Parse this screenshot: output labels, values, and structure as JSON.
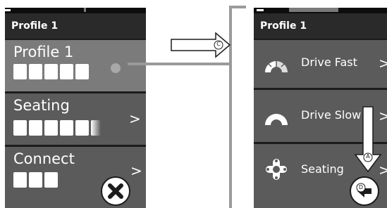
{
  "left": {
    "header": "Profile 1",
    "rows": [
      {
        "label": "Profile 1",
        "level": 5,
        "chevron": "",
        "active": true
      },
      {
        "label": "Seating",
        "level": 6,
        "chevron": ">",
        "active": false
      },
      {
        "label": "Connect",
        "level": 3,
        "chevron": ">",
        "active": false
      }
    ],
    "close_icon": "close-x-icon"
  },
  "right": {
    "header": "Profile 1",
    "rows": [
      {
        "label": "Drive Fast",
        "icon": "drive-fast-gauge-icon",
        "chevron": ">"
      },
      {
        "label": "Drive Slow",
        "icon": "drive-slow-gauge-icon",
        "chevron": ">"
      },
      {
        "label": "Seating",
        "icon": "seating-joystick-icon",
        "chevron": ">"
      }
    ],
    "back_icon": "back-arrow-icon"
  },
  "callouts": {
    "c": "C",
    "a": "A",
    "d": "D"
  },
  "colors": {
    "screen_bg": "#1c1c1c",
    "row": "#5b5b5b",
    "row_active": "#7b7b7b",
    "callout_line": "#9a9a9a"
  }
}
